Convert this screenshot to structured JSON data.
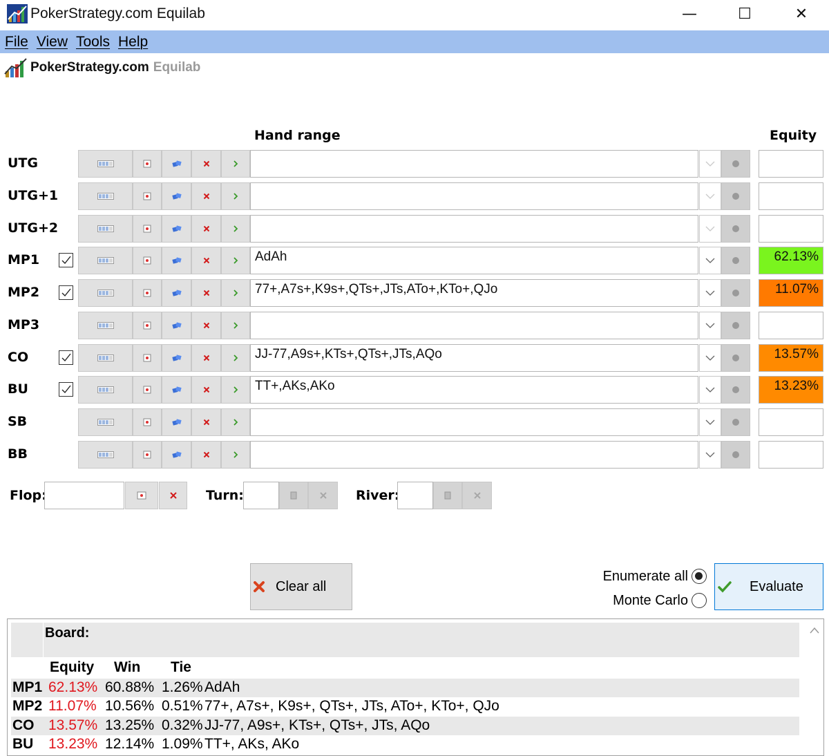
{
  "window": {
    "title": "PokerStrategy.com Equilab",
    "minimize": "—",
    "maximize": "☐",
    "close": "✕"
  },
  "menu": [
    "File",
    "View",
    "Tools",
    "Help"
  ],
  "logo": {
    "brand": "PokerStrategy.com",
    "product": "Equilab"
  },
  "headers": {
    "hand_range": "Hand range",
    "equity": "Equity"
  },
  "players": [
    {
      "name": "UTG",
      "checked": false,
      "range": "",
      "equity": "",
      "equity_color": ""
    },
    {
      "name": "UTG+1",
      "checked": false,
      "range": "",
      "equity": "",
      "equity_color": ""
    },
    {
      "name": "UTG+2",
      "checked": false,
      "range": "",
      "equity": "",
      "equity_color": ""
    },
    {
      "name": "MP1",
      "checked": true,
      "range": "AdAh",
      "equity": "62.13%",
      "equity_color": "#7af41e"
    },
    {
      "name": "MP2",
      "checked": true,
      "range": "77+,A7s+,K9s+,QTs+,JTs,ATo+,KTo+,QJo",
      "equity": "11.07%",
      "equity_color": "#ff7a00"
    },
    {
      "name": "MP3",
      "checked": false,
      "range": "",
      "equity": "",
      "equity_color": ""
    },
    {
      "name": "CO",
      "checked": true,
      "range": "JJ-77,A9s+,KTs+,QTs+,JTs,AQo",
      "equity": "13.57%",
      "equity_color": "#ff8a00"
    },
    {
      "name": "BU",
      "checked": true,
      "range": "TT+,AKs,AKo",
      "equity": "13.23%",
      "equity_color": "#ff8a00"
    },
    {
      "name": "SB",
      "checked": false,
      "range": "",
      "equity": "",
      "equity_color": ""
    },
    {
      "name": "BB",
      "checked": false,
      "range": "",
      "equity": "",
      "equity_color": ""
    }
  ],
  "board": {
    "flop_label": "Flop:",
    "turn_label": "Turn:",
    "river_label": "River:",
    "flop": "",
    "turn": "",
    "river": ""
  },
  "actions": {
    "clear_all": "Clear all",
    "enumerate_all": "Enumerate all",
    "monte_carlo": "Monte Carlo",
    "selected_mode": "enumerate_all",
    "evaluate": "Evaluate"
  },
  "results": {
    "board_label": "Board:",
    "columns": [
      "Equity",
      "Win",
      "Tie"
    ],
    "rows": [
      {
        "player": "MP1",
        "equity": "62.13%",
        "win": "60.88%",
        "tie": "1.26%",
        "hand": "AdAh"
      },
      {
        "player": "MP2",
        "equity": "11.07%",
        "win": "10.56%",
        "tie": "0.51%",
        "hand": "77+, A7s+, K9s+, QTs+, JTs, ATo+, KTo+, QJo"
      },
      {
        "player": "CO",
        "equity": "13.57%",
        "win": "13.25%",
        "tie": "0.32%",
        "hand": "JJ-77, A9s+, KTs+, QTs+, JTs, AQo"
      },
      {
        "player": "BU",
        "equity": "13.23%",
        "win": "12.14%",
        "tie": "1.09%",
        "hand": "TT+, AKs, AKo"
      }
    ]
  }
}
